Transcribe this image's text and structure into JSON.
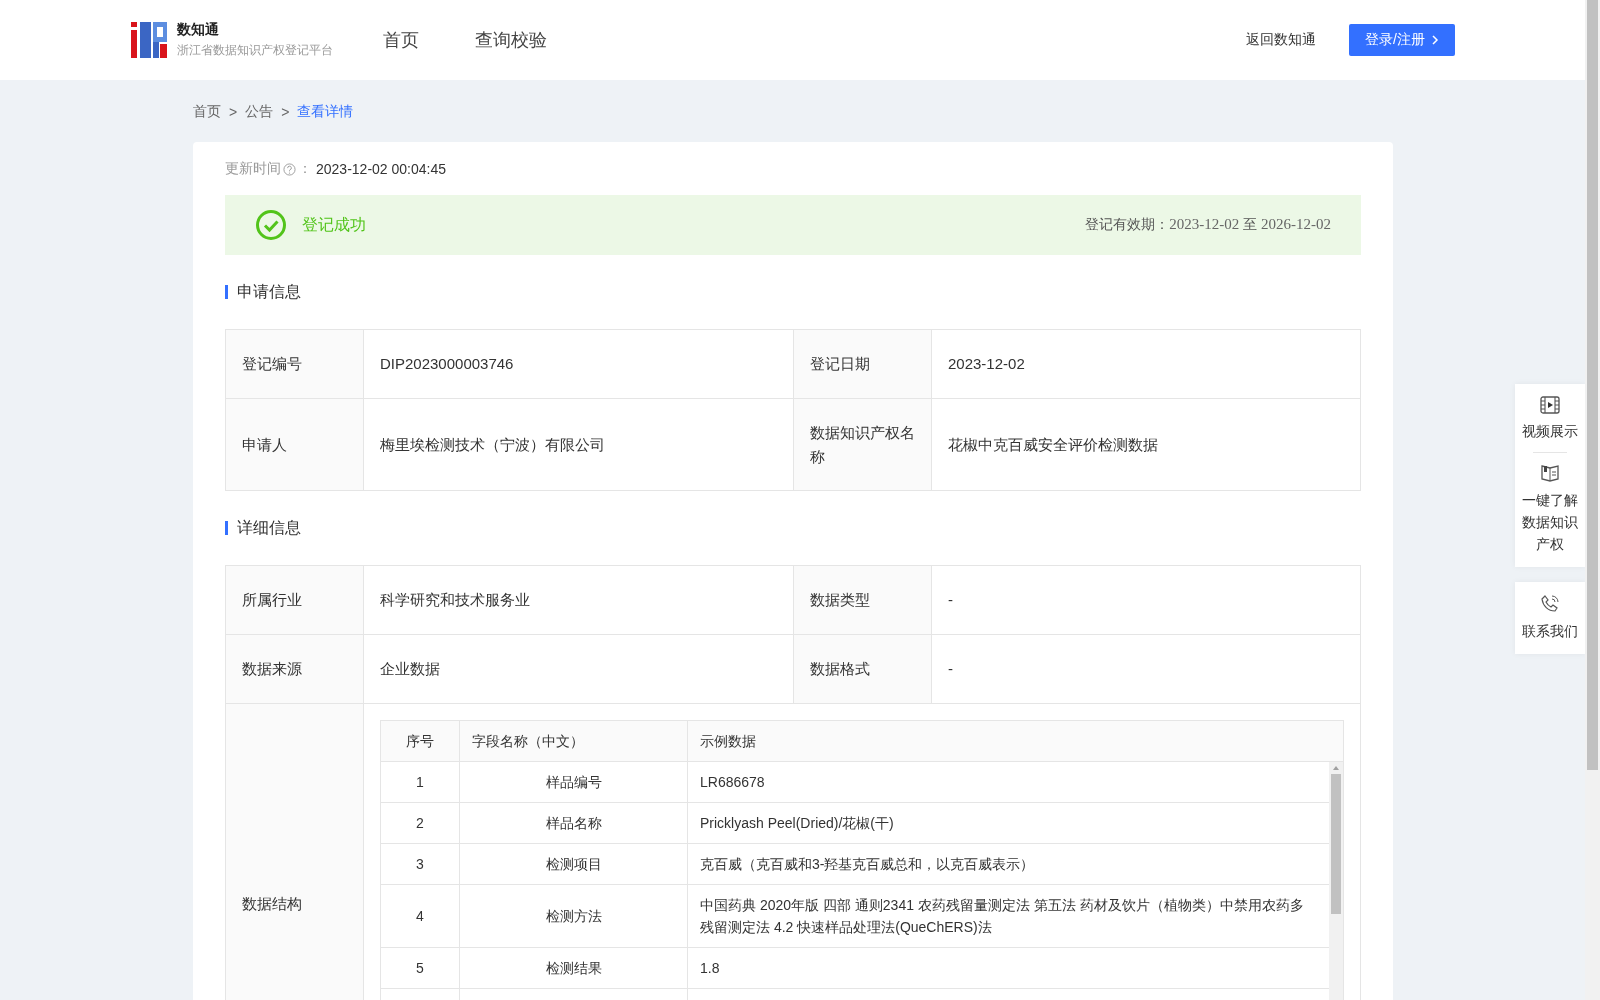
{
  "header": {
    "logo_title": "数知通",
    "logo_subtitle": "浙江省数据知识产权登记平台",
    "nav": [
      {
        "label": "首页",
        "selected": false
      },
      {
        "label": "查询校验",
        "selected": false
      }
    ],
    "return_link": "返回数知通",
    "login_button": "登录/注册"
  },
  "breadcrumb": [
    {
      "label": "首页",
      "selected": false
    },
    {
      "label": "公告",
      "selected": false
    },
    {
      "label": "查看详情",
      "selected": true
    }
  ],
  "separator": ">",
  "update": {
    "label": "更新时间",
    "colon": "：",
    "value": "2023-12-02 00:04:45"
  },
  "status": {
    "kind": "success",
    "text": "登记成功",
    "validity_label": "登记有效期：",
    "validity_from": "2023-12-02",
    "validity_to_word": "至",
    "validity_to": "2026-12-02"
  },
  "application": {
    "title": "申请信息",
    "rows": [
      {
        "cells": [
          {
            "label": "登记编号",
            "value": "DIP2023000003746"
          },
          {
            "label": "登记日期",
            "value": "2023-12-02"
          }
        ]
      },
      {
        "cells": [
          {
            "label": "申请人",
            "value": "梅里埃检测技术（宁波）有限公司"
          },
          {
            "label": "数据知识产权名称",
            "value": "花椒中克百威安全评价检测数据"
          }
        ]
      }
    ]
  },
  "details": {
    "title": "详细信息",
    "rows": [
      {
        "cells": [
          {
            "label": "所属行业",
            "value": "科学研究和技术服务业"
          },
          {
            "label": "数据类型",
            "value": "-"
          }
        ]
      },
      {
        "cells": [
          {
            "label": "数据来源",
            "value": "企业数据"
          },
          {
            "label": "数据格式",
            "value": "-"
          }
        ]
      }
    ],
    "structure": {
      "label": "数据结构",
      "columns": [
        "序号",
        "字段名称（中文）",
        "示例数据"
      ],
      "rows": [
        {
          "no": "1",
          "field": "样品编号",
          "sample": "LR686678"
        },
        {
          "no": "2",
          "field": "样品名称",
          "sample": "Pricklyash Peel(Dried)/花椒(干)"
        },
        {
          "no": "3",
          "field": "检测项目",
          "sample": "克百威（克百威和3-羟基克百威总和，以克百威表示）"
        },
        {
          "no": "4",
          "field": "检测方法",
          "sample": "中国药典 2020年版 四部 通则2341 农药残留量测定法 第五法 药材及饮片（植物类）中禁用农药多残留测定法 4.2 快速样品处理法(QueChERS)法"
        },
        {
          "no": "5",
          "field": "检测结果",
          "sample": "1.8"
        }
      ]
    }
  },
  "float_panel": [
    {
      "kind": "video",
      "label": "视频展示"
    },
    {
      "kind": "book",
      "label": "一键了解数据知识产权"
    },
    {
      "kind": "phone",
      "label": "联系我们"
    }
  ]
}
